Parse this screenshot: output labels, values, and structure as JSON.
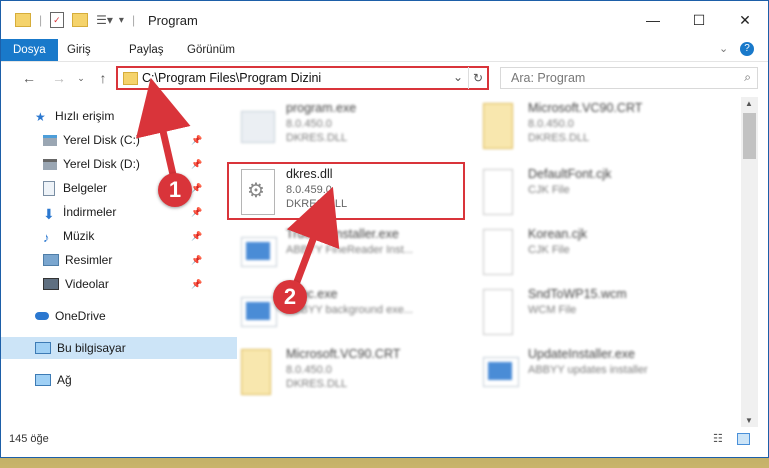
{
  "window": {
    "title": "Program"
  },
  "ribbon": {
    "tabs": [
      "Dosya",
      "Giriş",
      "Paylaş",
      "Görünüm"
    ]
  },
  "address": {
    "path": "C:\\Program Files\\Program Dizini"
  },
  "search": {
    "placeholder": "Ara: Program"
  },
  "sidebar": {
    "items": [
      {
        "label": "Hızlı erişim"
      },
      {
        "label": "Yerel Disk (C:)"
      },
      {
        "label": "Yerel Disk (D:)"
      },
      {
        "label": "Belgeler"
      },
      {
        "label": "İndirmeler"
      },
      {
        "label": "Müzik"
      },
      {
        "label": "Resimler"
      },
      {
        "label": "Videolar"
      },
      {
        "label": "OneDrive"
      },
      {
        "label": "Bu bilgisayar"
      },
      {
        "label": "Ağ"
      }
    ]
  },
  "files": [
    {
      "name": "program.exe",
      "l2": "8.0.450.0",
      "l3": "DKRES.DLL"
    },
    {
      "name": "Microsoft.VC90.CRT",
      "l2": "8.0.450.0",
      "l3": "DKRES.DLL"
    },
    {
      "name": "dkres.dll",
      "l2": "8.0.459.0",
      "l3": "DKRES.DLL"
    },
    {
      "name": "DefaultFont.cjk",
      "l2": "CJK File",
      "l3": ""
    },
    {
      "name": "TrueImeInstaller.exe",
      "l2": "ABBYY FineReader Inst...",
      "l3": ""
    },
    {
      "name": "Korean.cjk",
      "l2": "CJK File",
      "l3": ""
    },
    {
      "name": "Exec.exe",
      "l2": "ABBYY background exe...",
      "l3": ""
    },
    {
      "name": "SndToWP15.wcm",
      "l2": "WCM File",
      "l3": ""
    },
    {
      "name": "Microsoft.VC90.CRT",
      "l2": "8.0.450.0",
      "l3": "DKRES.DLL"
    },
    {
      "name": "UpdateInstaller.exe",
      "l2": "ABBYY updates installer",
      "l3": ""
    }
  ],
  "status": {
    "count": "145 öğe"
  },
  "badges": [
    "1",
    "2"
  ],
  "colors": {
    "accent": "#1979ca",
    "highlight": "#d9343a",
    "selection": "#cce4f7"
  }
}
